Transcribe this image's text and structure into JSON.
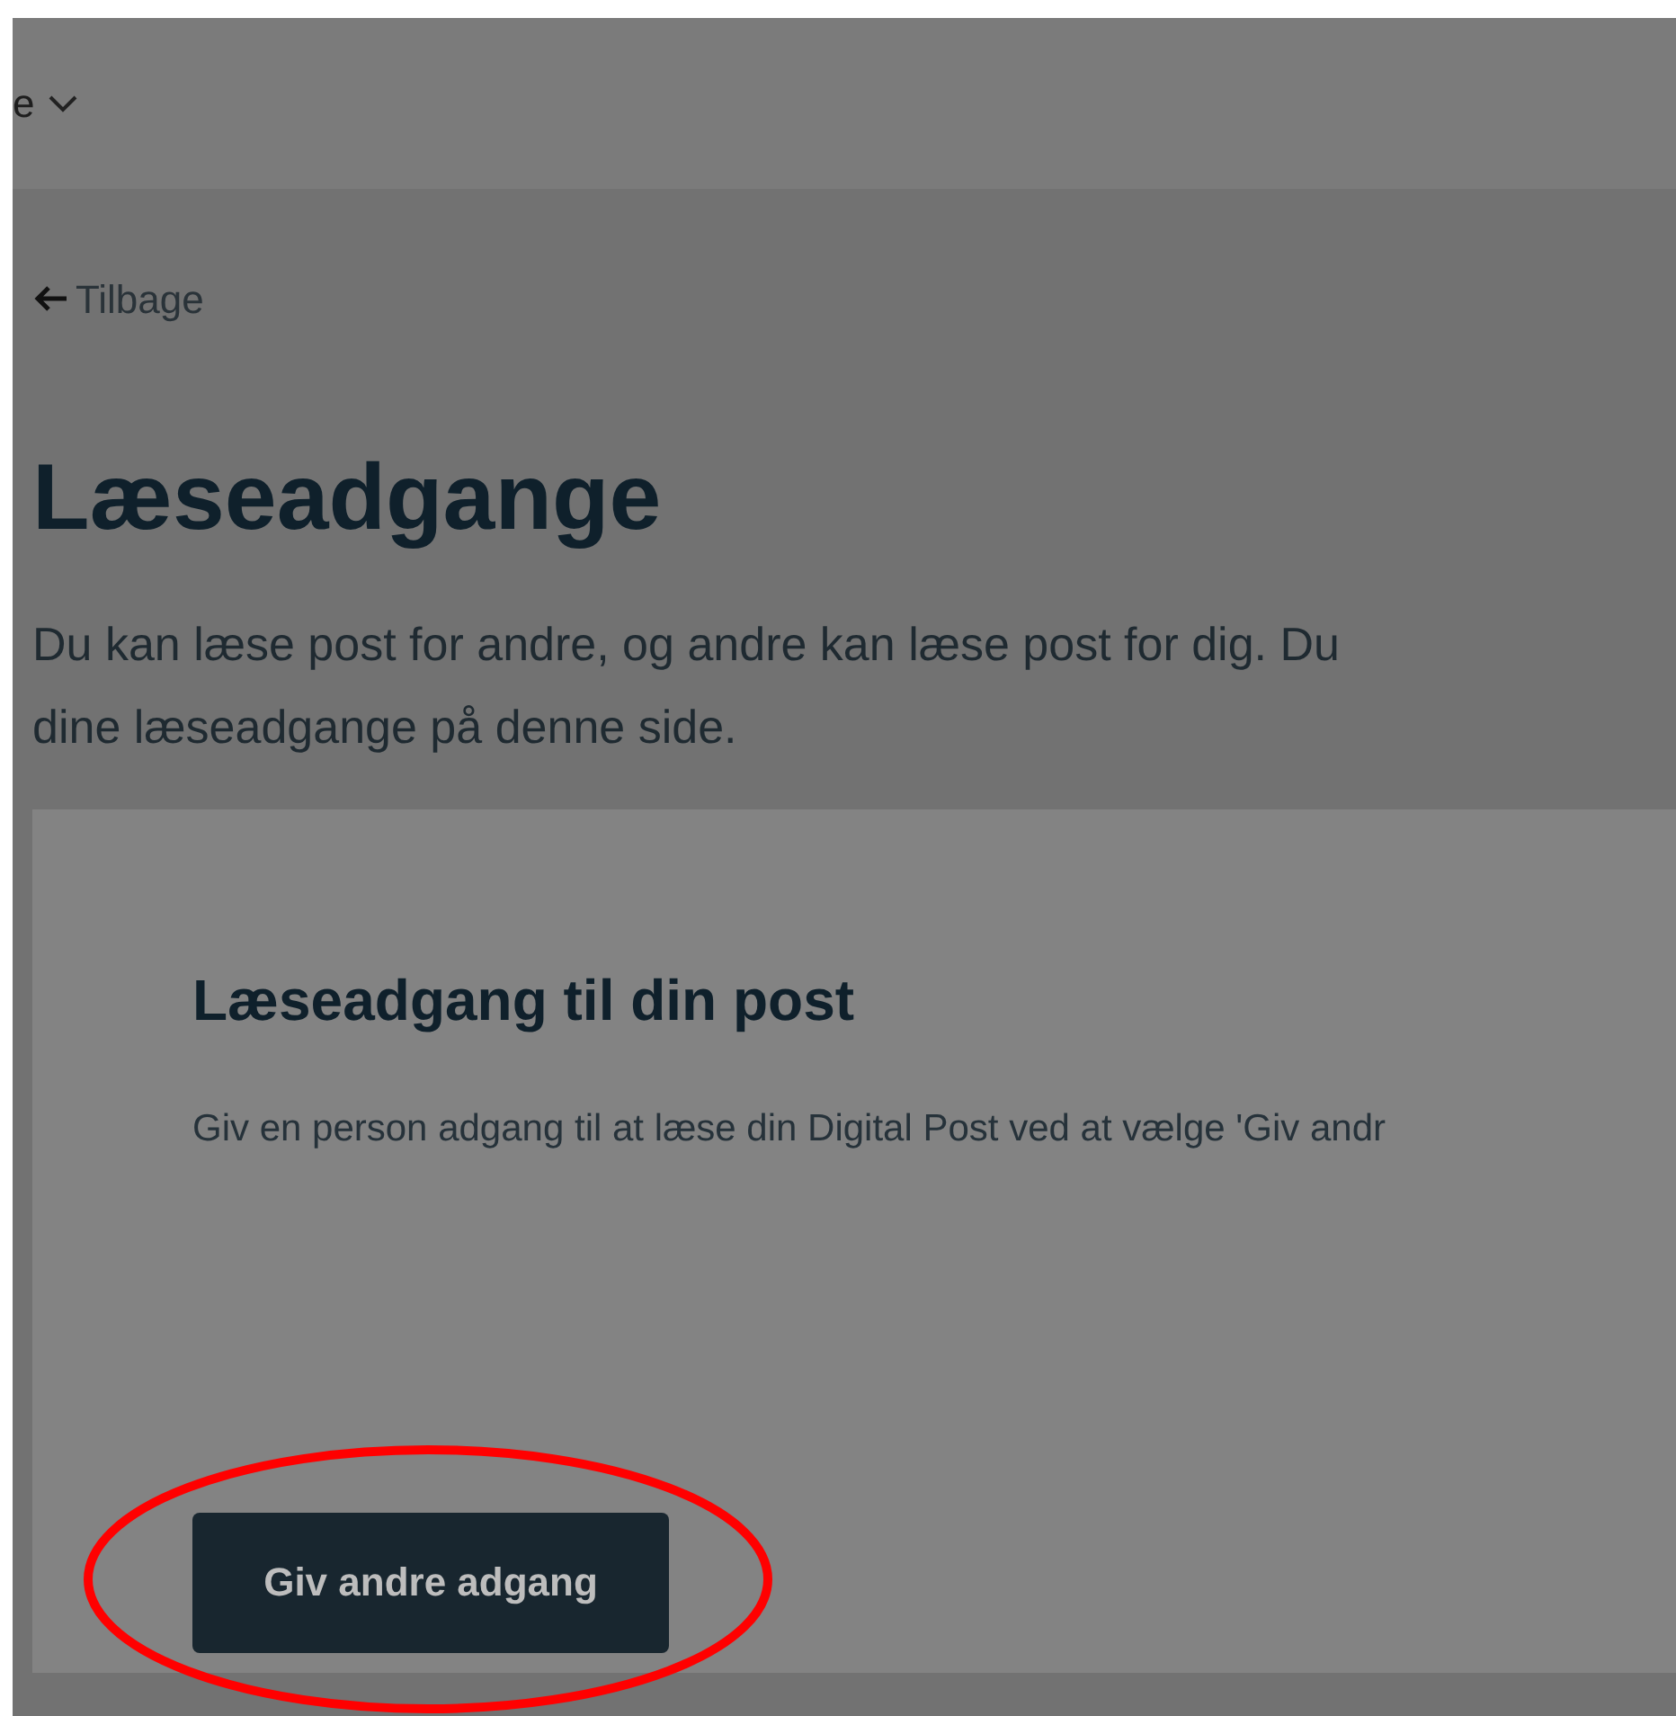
{
  "header": {
    "menu_label": "e"
  },
  "back_link": {
    "label": "Tilbage"
  },
  "page_title": "Læseadgange",
  "intro_lines": [
    "Du kan læse post for andre, og andre kan læse post for dig. Du",
    "dine læseadgange på denne side."
  ],
  "card": {
    "title": "Læseadgang til din post",
    "text": "Giv en person adgang til at læse din Digital Post ved at vælge 'Giv andr",
    "button": "Giv andre adgang"
  }
}
